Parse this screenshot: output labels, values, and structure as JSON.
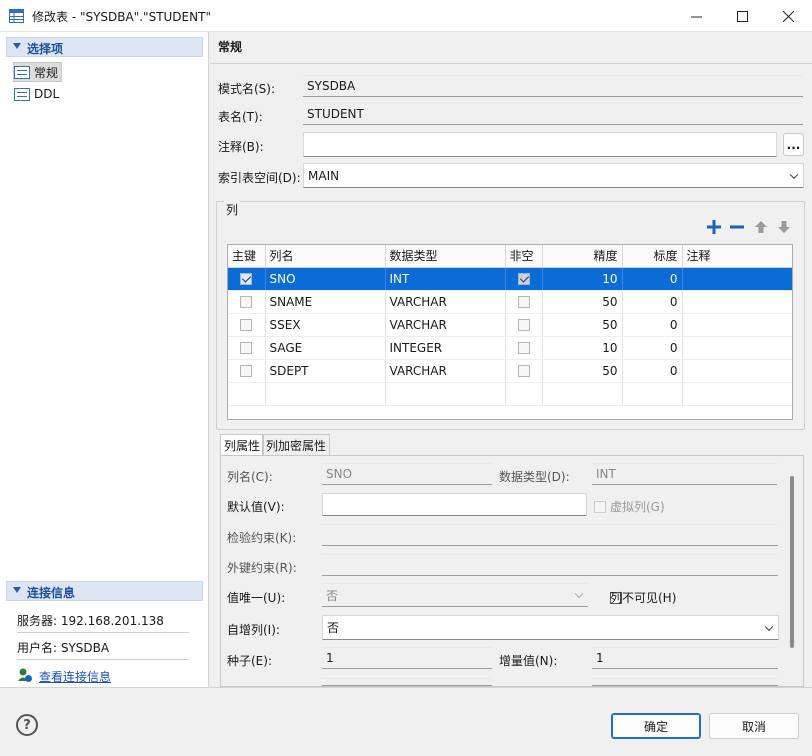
{
  "window": {
    "title": "修改表 - \"SYSDBA\".\"STUDENT\""
  },
  "nav": {
    "section_label": "选择项",
    "items": [
      {
        "label": "常规"
      },
      {
        "label": "DDL"
      }
    ]
  },
  "conn": {
    "section_label": "连接信息",
    "server": "服务器: 192.168.201.138",
    "user": "用户名: SYSDBA",
    "link_label": "查看连接信息"
  },
  "general": {
    "title": "常规",
    "schema_label": "模式名(S):",
    "schema_value": "SYSDBA",
    "table_label": "表名(T):",
    "table_value": "STUDENT",
    "comment_label": "注释(B):",
    "comment_value": "",
    "dots_label": "...",
    "tablespace_label": "索引表空间(D):",
    "tablespace_value": "MAIN"
  },
  "columns": {
    "group_label": "列",
    "headers": [
      "主键",
      "列名",
      "数据类型",
      "非空",
      "精度",
      "标度",
      "注释"
    ],
    "rows": [
      {
        "pk": true,
        "name": "SNO",
        "type": "INT",
        "notnull": true,
        "precision": "10",
        "scale": "0",
        "comment": ""
      },
      {
        "pk": false,
        "name": "SNAME",
        "type": "VARCHAR",
        "notnull": false,
        "precision": "50",
        "scale": "0",
        "comment": ""
      },
      {
        "pk": false,
        "name": "SSEX",
        "type": "VARCHAR",
        "notnull": false,
        "precision": "50",
        "scale": "0",
        "comment": ""
      },
      {
        "pk": false,
        "name": "SAGE",
        "type": "INTEGER",
        "notnull": false,
        "precision": "10",
        "scale": "0",
        "comment": ""
      },
      {
        "pk": false,
        "name": "SDEPT",
        "type": "VARCHAR",
        "notnull": false,
        "precision": "50",
        "scale": "0",
        "comment": ""
      }
    ],
    "selected_row": 0
  },
  "props": {
    "tabs": [
      "列属性",
      "列加密属性"
    ],
    "colname_label": "列名(C):",
    "colname_value": "SNO",
    "datatype_label": "数据类型(D):",
    "datatype_value": "INT",
    "default_label": "默认值(V):",
    "default_value": "",
    "virtual_label": "虚拟列(G)",
    "check_label": "检验约束(K):",
    "fk_label": "外键约束(R):",
    "unique_label": "值唯一(U):",
    "unique_value": "否",
    "invisible_label": "列不可见(H)",
    "autoinc_label": "自增列(I):",
    "autoinc_value": "否",
    "seed_label": "种子(E):",
    "seed_value": "1",
    "increment_label": "增量值(N):",
    "increment_value": "1"
  },
  "buttons": {
    "help": "?",
    "ok": "确定",
    "cancel": "取消"
  },
  "colors": {
    "accent": "#0b6bd7",
    "section_header": "#dce6f3",
    "link": "#1a4fbf"
  }
}
